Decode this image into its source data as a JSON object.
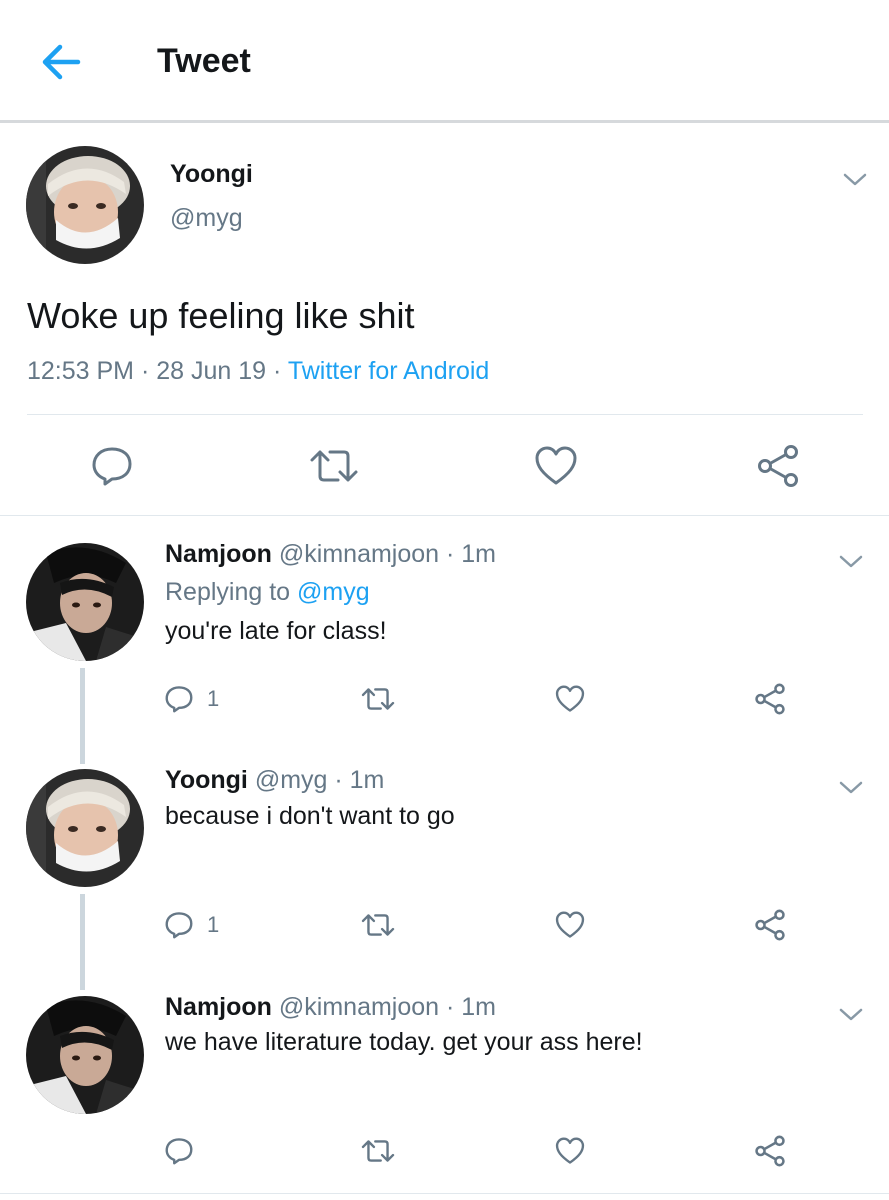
{
  "header": {
    "title": "Tweet"
  },
  "main_tweet": {
    "name": "Yoongi",
    "handle": "@myg",
    "text": "Woke up feeling like shit",
    "time": "12:53 PM",
    "date": "28 Jun 19",
    "source": "Twitter for Android",
    "separator": " · "
  },
  "replies": [
    {
      "name": "Namjoon",
      "handle": "@kimnamjoon",
      "time": "1m",
      "replying_prefix": "Replying to",
      "replying_to": "@myg",
      "text": "you're late for class!",
      "reply_count": "1"
    },
    {
      "name": "Yoongi",
      "handle": "@myg",
      "time": "1m",
      "text": "because i don't want to go",
      "reply_count": "1"
    },
    {
      "name": "Namjoon",
      "handle": "@kimnamjoon",
      "time": "1m",
      "text": "we have literature today. get your ass here!",
      "reply_count": ""
    }
  ],
  "icons": {
    "back": "arrow-left-icon",
    "menu": "chevron-down-icon",
    "reply": "comment-icon",
    "retweet": "retweet-icon",
    "like": "heart-icon",
    "share": "share-icon"
  },
  "colors": {
    "accent": "#1da1f2",
    "secondary_text": "#657786",
    "icon": "#657786"
  }
}
